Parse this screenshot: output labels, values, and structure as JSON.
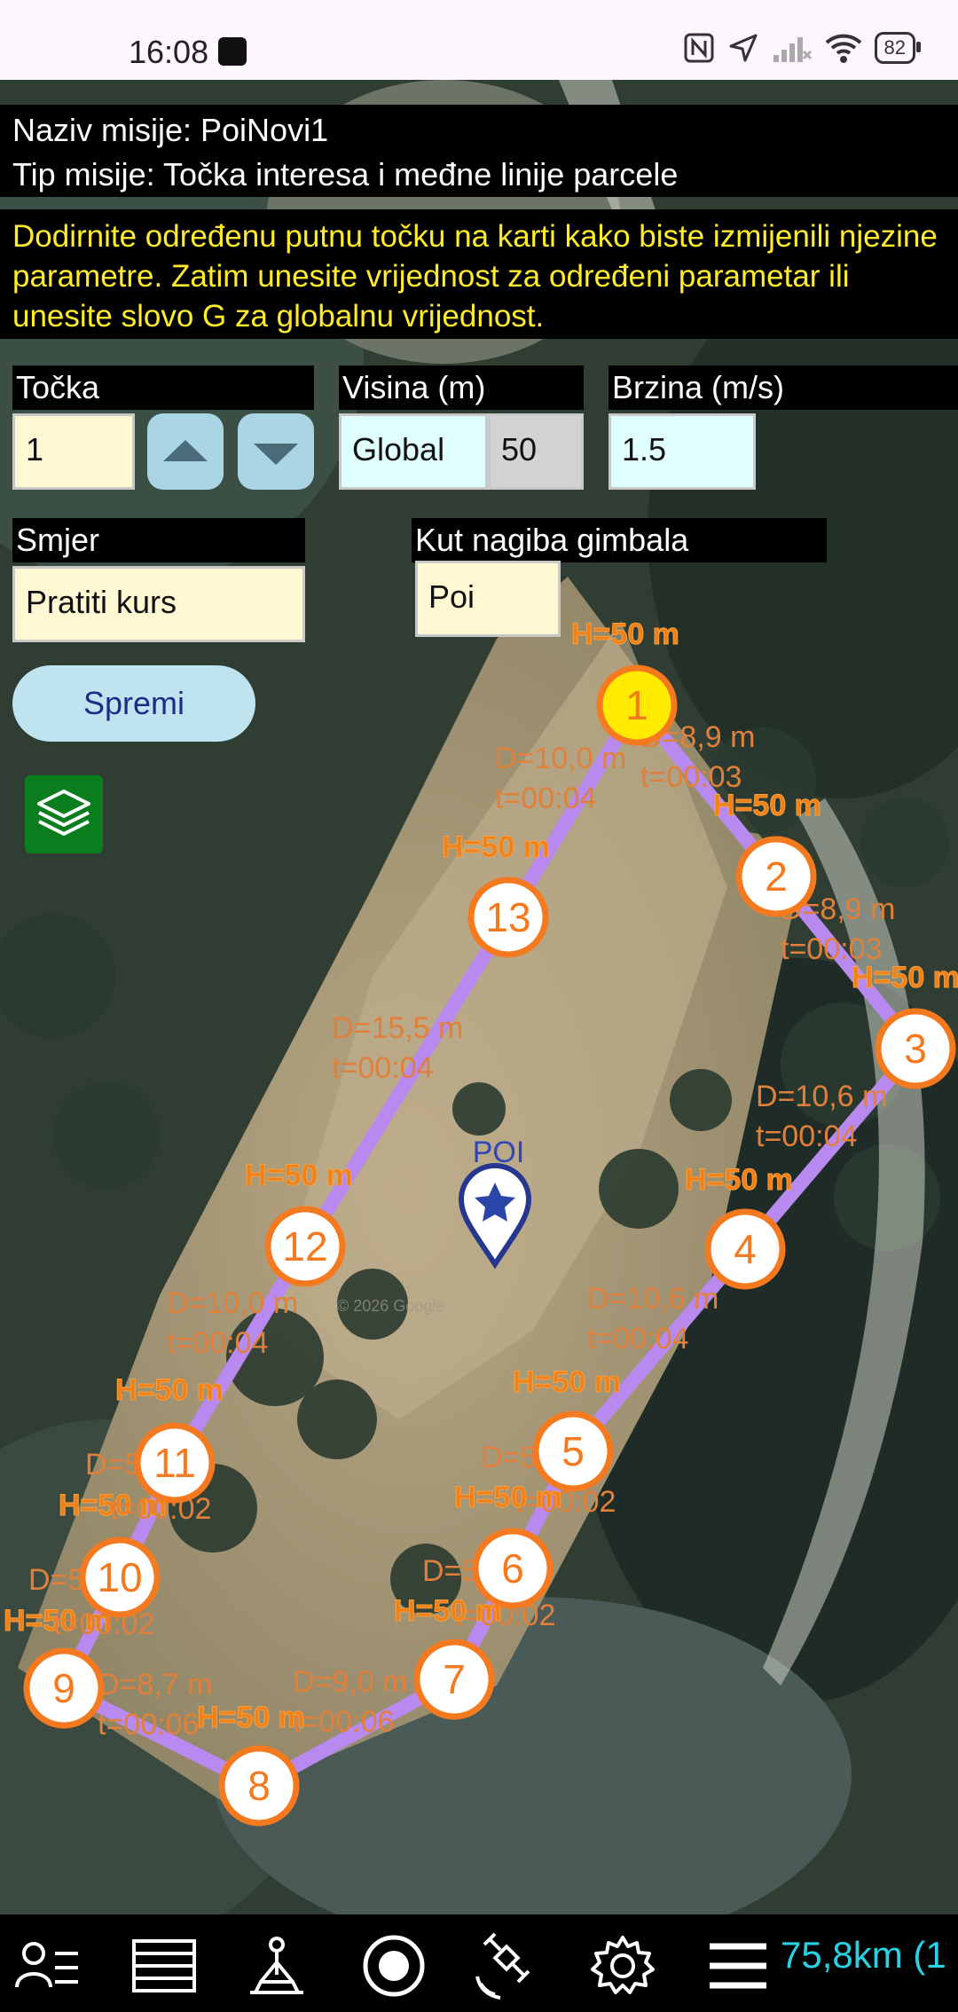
{
  "status_bar": {
    "time": "16:08",
    "battery": "82"
  },
  "mission": {
    "name_line": "Naziv misije: PoiNovi1",
    "type_line": "Tip misije: Točka interesa i međne linije parcele",
    "hint": "Dodirnite određenu putnu točku na karti kako biste izmijenili njezine parametre. Zatim unesite vrijednost za određeni parametar ili unesite slovo G za globalnu vrijednost."
  },
  "form": {
    "point_label": "Točka",
    "point_value": "1",
    "altitude_label": "Visina (m)",
    "altitude_mode": "Global",
    "altitude_value": "50",
    "speed_label": "Brzina (m/s)",
    "speed_value": "1.5",
    "heading_label": "Smjer",
    "heading_value": "Pratiti kurs",
    "gimbal_label": "Kut nagiba gimbala",
    "gimbal_value": "Poi",
    "save_label": "Spremi"
  },
  "map": {
    "poi_label": "POI",
    "watermark": "© 2026 Google",
    "waypoints": [
      {
        "id": "1",
        "h": "H=50 m",
        "d": "D=8,9 m",
        "t": "t=00:03",
        "active": true
      },
      {
        "id": "2",
        "h": "H=50 m",
        "d": "D=8,9 m",
        "t": "t=00:03"
      },
      {
        "id": "3",
        "h": "H=50 m",
        "d": "D=10,6 m",
        "t": "t=00:04"
      },
      {
        "id": "4",
        "h": "H=50 m",
        "d": "D=10,6 m",
        "t": "t=00:04"
      },
      {
        "id": "5",
        "h": "H=50 m",
        "d": "D=5,2 m",
        "t": "t=00:02"
      },
      {
        "id": "6",
        "h": "H=50 m",
        "d": "D=5,1 m",
        "t": "t=00:02"
      },
      {
        "id": "7",
        "h": "H=50 m",
        "d": "D=9,0 m",
        "t": "t=00:06"
      },
      {
        "id": "8",
        "h": "H=50 m",
        "d": "D=8,7 m",
        "t": "t=00:06"
      },
      {
        "id": "9",
        "h": "H=50 m",
        "d": "D=5,1 m",
        "t": "t=00:02"
      },
      {
        "id": "10",
        "h": "H=50 m",
        "d": "D=5,1 m",
        "t": "t=00:02"
      },
      {
        "id": "11",
        "h": "H=50 m",
        "d": "D=10,0 m",
        "t": "t=00:04"
      },
      {
        "id": "12",
        "h": "H=50 m",
        "d": "D=15,5 m",
        "t": "t=00:04"
      },
      {
        "id": "13",
        "h": "H=50 m",
        "d": "D=10,0 m",
        "t": "t=00:04"
      }
    ]
  },
  "bottom_bar": {
    "distance": "75,8km (1"
  },
  "colors": {
    "path": "#b88af0",
    "waypoint_ring": "#f57a1f",
    "active_waypoint": "#ffea00",
    "hint_text": "#ffec2a",
    "distance_text": "#27d2e4"
  }
}
